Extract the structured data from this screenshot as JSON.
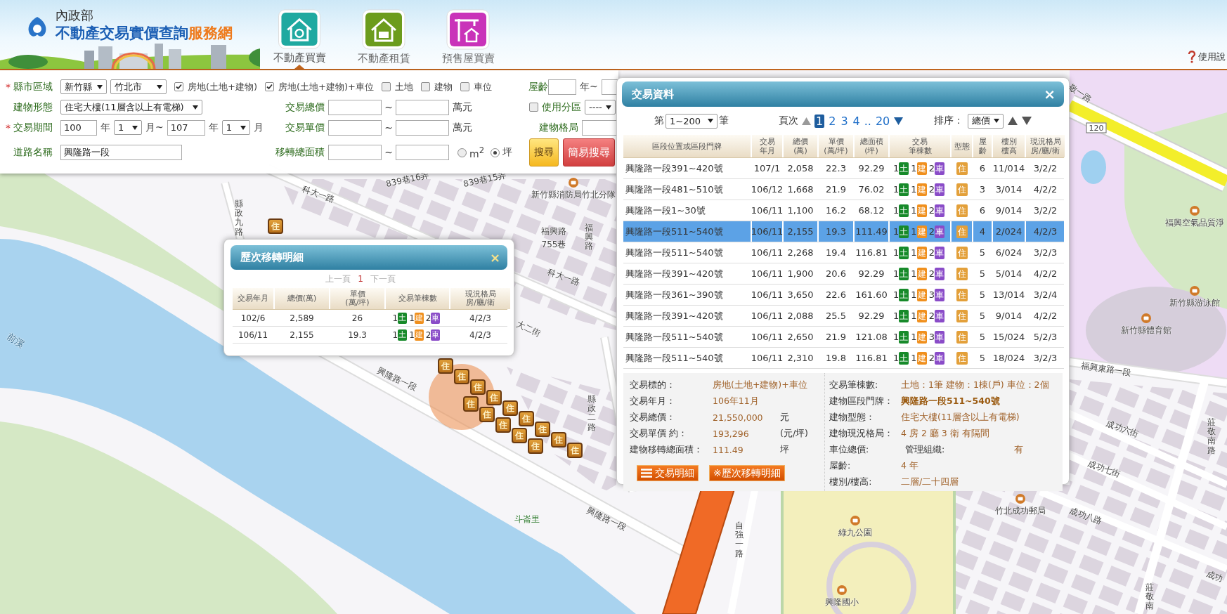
{
  "header": {
    "org": "內政部",
    "title": "不動產交易實價查詢",
    "title_accent": "服務網",
    "nav": [
      {
        "label": "不動產買賣",
        "kind": "sale",
        "selected": true
      },
      {
        "label": "不動產租賃",
        "kind": "rent",
        "selected": false
      },
      {
        "label": "預售屋買賣",
        "kind": "presale",
        "selected": false
      }
    ],
    "help": "使用說"
  },
  "search": {
    "region": {
      "required_mark": "*",
      "label": "縣市區域",
      "county": "新竹縣",
      "district": "竹北市"
    },
    "targets": [
      {
        "label": "房地(土地+建物)",
        "checked": true
      },
      {
        "label": "房地(土地+建物)+車位",
        "checked": true
      },
      {
        "label": "土地",
        "checked": false
      },
      {
        "label": "建物",
        "checked": false
      },
      {
        "label": "車位",
        "checked": false
      }
    ],
    "age": {
      "label": "屋齡",
      "unit": "年~"
    },
    "building_type": {
      "label": "建物形態",
      "value": "住宅大樓(11層含以上有電梯)"
    },
    "total_price": {
      "label": "交易總價",
      "sep": "~",
      "unit": "萬元"
    },
    "zoning": {
      "label": "使用分區",
      "checked": false,
      "value": "----"
    },
    "period": {
      "required_mark": "*",
      "label": "交易期間",
      "from_year": "100",
      "year_unit": "年",
      "from_month": "1",
      "month_unit": "月~",
      "to_year": "107",
      "to_year_unit": "年",
      "to_month": "1",
      "to_month_unit": "月"
    },
    "unit_price": {
      "label": "交易單價",
      "sep": "~",
      "unit": "萬元"
    },
    "layout": {
      "label": "建物格局"
    },
    "road": {
      "label": "道路名稱",
      "value": "興隆路一段"
    },
    "area": {
      "label": "移轉總面積",
      "sep": "~",
      "units": [
        {
          "label": "m$^{2}$",
          "selected": false
        },
        {
          "label": "坪",
          "selected": true
        }
      ]
    },
    "buttons": [
      {
        "label": "搜尋",
        "kind": "search"
      },
      {
        "label": "簡易搜尋",
        "kind": "simple"
      }
    ]
  },
  "deals": {
    "title": "交易資料",
    "close": "×",
    "range": {
      "prefix": "第",
      "value": "1~200",
      "suffix": "筆"
    },
    "pager": {
      "label": "頁次",
      "gap": "..",
      "pages": [
        {
          "label": "1",
          "selected": true
        },
        {
          "label": "2",
          "selected": false
        },
        {
          "label": "3",
          "selected": false
        },
        {
          "label": "4",
          "selected": false
        },
        {
          "label": "20",
          "selected": false
        }
      ]
    },
    "sort": {
      "label": "排序：",
      "value": "總價"
    },
    "columns": [
      [
        "區段位置或區段門牌"
      ],
      [
        "交易",
        "年月"
      ],
      [
        "總價",
        "(萬)"
      ],
      [
        "單價",
        "(萬/坪)"
      ],
      [
        "總面積",
        "(坪)"
      ],
      [
        "交易",
        "筆棟數"
      ],
      [
        "型態"
      ],
      [
        "屋",
        "齡"
      ],
      [
        "樓別",
        "樓高"
      ],
      [
        "現況格局",
        "房/廳/衛"
      ]
    ],
    "rows": [
      {
        "address": "興隆路一段391~420號",
        "date": "107/1",
        "total": "2,058",
        "unit": "22.3",
        "area": "92.29",
        "counts": [
          {
            "n": "1",
            "tag": "土",
            "kind": "land"
          },
          {
            "n": "1",
            "tag": "建",
            "kind": "building"
          },
          {
            "n": "2",
            "tag": "車",
            "kind": "parking"
          }
        ],
        "type": "住",
        "age": "6",
        "floor": "11/014",
        "layout": "3/2/2",
        "selected": false
      },
      {
        "address": "興隆路一段481~510號",
        "date": "106/12",
        "total": "1,668",
        "unit": "21.9",
        "area": "76.02",
        "counts": [
          {
            "n": "1",
            "tag": "土",
            "kind": "land"
          },
          {
            "n": "1",
            "tag": "建",
            "kind": "building"
          },
          {
            "n": "2",
            "tag": "車",
            "kind": "parking"
          }
        ],
        "type": "住",
        "age": "3",
        "floor": "3/014",
        "layout": "4/2/2",
        "selected": false
      },
      {
        "address": "興隆路一段1~30號",
        "date": "106/11",
        "total": "1,100",
        "unit": "16.2",
        "area": "68.12",
        "counts": [
          {
            "n": "1",
            "tag": "土",
            "kind": "land"
          },
          {
            "n": "1",
            "tag": "建",
            "kind": "building"
          },
          {
            "n": "2",
            "tag": "車",
            "kind": "parking"
          }
        ],
        "type": "住",
        "age": "6",
        "floor": "9/014",
        "layout": "3/2/2",
        "selected": false
      },
      {
        "address": "興隆路一段511~540號",
        "date": "106/11",
        "total": "2,155",
        "unit": "19.3",
        "area": "111.49",
        "counts": [
          {
            "n": "1",
            "tag": "土",
            "kind": "land"
          },
          {
            "n": "1",
            "tag": "建",
            "kind": "building"
          },
          {
            "n": "2",
            "tag": "車",
            "kind": "parking"
          }
        ],
        "type": "住",
        "age": "4",
        "floor": "2/024",
        "layout": "4/2/3",
        "selected": true
      },
      {
        "address": "興隆路一段511~540號",
        "date": "106/11",
        "total": "2,268",
        "unit": "19.4",
        "area": "116.81",
        "counts": [
          {
            "n": "1",
            "tag": "土",
            "kind": "land"
          },
          {
            "n": "1",
            "tag": "建",
            "kind": "building"
          },
          {
            "n": "2",
            "tag": "車",
            "kind": "parking"
          }
        ],
        "type": "住",
        "age": "5",
        "floor": "6/024",
        "layout": "3/2/3",
        "selected": false
      },
      {
        "address": "興隆路一段391~420號",
        "date": "106/11",
        "total": "1,900",
        "unit": "20.6",
        "area": "92.29",
        "counts": [
          {
            "n": "1",
            "tag": "土",
            "kind": "land"
          },
          {
            "n": "1",
            "tag": "建",
            "kind": "building"
          },
          {
            "n": "2",
            "tag": "車",
            "kind": "parking"
          }
        ],
        "type": "住",
        "age": "5",
        "floor": "5/014",
        "layout": "4/2/2",
        "selected": false
      },
      {
        "address": "興隆路一段361~390號",
        "date": "106/11",
        "total": "3,650",
        "unit": "22.6",
        "area": "161.60",
        "counts": [
          {
            "n": "1",
            "tag": "土",
            "kind": "land"
          },
          {
            "n": "1",
            "tag": "建",
            "kind": "building"
          },
          {
            "n": "3",
            "tag": "車",
            "kind": "parking"
          }
        ],
        "type": "住",
        "age": "5",
        "floor": "13/014",
        "layout": "3/2/4",
        "selected": false
      },
      {
        "address": "興隆路一段391~420號",
        "date": "106/11",
        "total": "2,088",
        "unit": "25.5",
        "area": "92.29",
        "counts": [
          {
            "n": "1",
            "tag": "土",
            "kind": "land"
          },
          {
            "n": "1",
            "tag": "建",
            "kind": "building"
          },
          {
            "n": "2",
            "tag": "車",
            "kind": "parking"
          }
        ],
        "type": "住",
        "age": "5",
        "floor": "9/014",
        "layout": "4/2/2",
        "selected": false
      },
      {
        "address": "興隆路一段511~540號",
        "date": "106/11",
        "total": "2,650",
        "unit": "21.9",
        "area": "121.08",
        "counts": [
          {
            "n": "1",
            "tag": "土",
            "kind": "land"
          },
          {
            "n": "1",
            "tag": "建",
            "kind": "building"
          },
          {
            "n": "3",
            "tag": "車",
            "kind": "parking"
          }
        ],
        "type": "住",
        "age": "5",
        "floor": "15/024",
        "layout": "5/2/3",
        "selected": false
      },
      {
        "address": "興隆路一段511~540號",
        "date": "106/11",
        "total": "2,310",
        "unit": "19.8",
        "area": "116.81",
        "counts": [
          {
            "n": "1",
            "tag": "土",
            "kind": "land"
          },
          {
            "n": "1",
            "tag": "建",
            "kind": "building"
          },
          {
            "n": "2",
            "tag": "車",
            "kind": "parking"
          }
        ],
        "type": "住",
        "age": "5",
        "floor": "18/024",
        "layout": "3/2/3",
        "selected": false
      }
    ],
    "detail": {
      "left": [
        {
          "label": "交易標的：",
          "value": "房地(土地+建物)+車位"
        },
        {
          "label": "交易年月：",
          "value": "106年11月"
        },
        {
          "label": "交易總價：",
          "value": "21,550,000",
          "unit": "元"
        },
        {
          "label": "交易單價 約：",
          "value": "193,296",
          "unit": "(元/坪)"
        },
        {
          "label": "建物移轉總面積：",
          "value": "111.49",
          "unit": "坪"
        }
      ],
      "buttons": [
        {
          "label": "交易明細",
          "kind": "list"
        },
        {
          "label": "※歷次移轉明細",
          "kind": "history"
        }
      ],
      "right": [
        {
          "label": "交易筆棟數:",
          "value": "土地：1筆 建物：1棟(戶) 車位：2個",
          "bold": false
        },
        {
          "label": "建物區段門牌：",
          "value": "興隆路一段511~540號",
          "bold": true
        },
        {
          "label": "建物型態：",
          "value": "住宅大樓(11層含以上有電梯)",
          "bold": false
        },
        {
          "label": "建物現況格局：",
          "value": "4 房 2 廳 3 衛 有隔間",
          "bold": false
        },
        {
          "label": "車位總價:",
          "sub_label": "管理組織:",
          "sub_value": "有",
          "bold": false
        },
        {
          "label": "屋齡:",
          "value": "4  年",
          "bold": false
        },
        {
          "label": "樓別/樓高:",
          "value": "二層/二十四層",
          "bold": false
        }
      ]
    }
  },
  "history": {
    "title": "歷次移轉明細",
    "close": "×",
    "pager": {
      "prev": "上一頁",
      "current": "1",
      "next": "下一頁"
    },
    "columns": [
      [
        "交易年月"
      ],
      [
        "總價(萬)"
      ],
      [
        "單價",
        "(萬/坪)"
      ],
      [
        "交易筆棟數"
      ],
      [
        "現況格局",
        "房/廳/衛"
      ]
    ],
    "rows": [
      {
        "date": "102/6",
        "total": "2,589",
        "unit": "26",
        "counts": [
          {
            "n": "1",
            "tag": "土",
            "kind": "land"
          },
          {
            "n": "1",
            "tag": "建",
            "kind": "building"
          },
          {
            "n": "2",
            "tag": "車",
            "kind": "parking"
          }
        ],
        "layout": "4/2/3"
      },
      {
        "date": "106/11",
        "total": "2,155",
        "unit": "19.3",
        "counts": [
          {
            "n": "1",
            "tag": "土",
            "kind": "land"
          },
          {
            "n": "1",
            "tag": "建",
            "kind": "building"
          },
          {
            "n": "2",
            "tag": "車",
            "kind": "parking"
          }
        ],
        "layout": "4/2/3"
      }
    ]
  },
  "map": {
    "labels": [
      {
        "text": "前溪",
        "kind": "water"
      },
      {
        "text": "縣政九路",
        "kind": "vertical"
      },
      {
        "text": "839巷16弄",
        "kind": "road"
      },
      {
        "text": "839巷15弄",
        "kind": "road"
      },
      {
        "text": "新竹縣消防局竹北分隊",
        "kind": "place"
      },
      {
        "text": "科大一路",
        "kind": "road"
      },
      {
        "text": "福興路",
        "kind": "road"
      },
      {
        "text": "755巷",
        "kind": "road"
      },
      {
        "text": "福興路",
        "kind": "vertical"
      },
      {
        "text": "科大一路",
        "kind": "road"
      },
      {
        "text": "大二街",
        "kind": "road"
      },
      {
        "text": "興隆路一段",
        "kind": "road"
      },
      {
        "text": "縣政二路",
        "kind": "vertical"
      },
      {
        "text": "斗崙里",
        "kind": "area"
      },
      {
        "text": "興隆路一段",
        "kind": "road"
      },
      {
        "text": "自強一路",
        "kind": "vertical"
      },
      {
        "text": "綠九公園",
        "kind": "place"
      },
      {
        "text": "竹北成功郵局",
        "kind": "place"
      },
      {
        "text": "興隆國小",
        "kind": "place"
      },
      {
        "text": "敬一路",
        "kind": "road"
      },
      {
        "text": "120",
        "kind": "shield"
      },
      {
        "text": "福興空氣品質淨",
        "kind": "place"
      },
      {
        "text": "新竹縣游泳館",
        "kind": "place"
      },
      {
        "text": "新竹縣體育館",
        "kind": "place"
      },
      {
        "text": "福興東路一段",
        "kind": "road"
      },
      {
        "text": "成功六街",
        "kind": "road"
      },
      {
        "text": "莊敬南路",
        "kind": "vertical"
      },
      {
        "text": "成功七街",
        "kind": "road"
      },
      {
        "text": "成功八路",
        "kind": "road"
      },
      {
        "text": "成功",
        "kind": "road"
      },
      {
        "text": "莊敬南",
        "kind": "vertical"
      }
    ],
    "markers": [
      {
        "label": "住"
      },
      {
        "label": "住"
      },
      {
        "label": "住"
      },
      {
        "label": "住"
      },
      {
        "label": "住"
      },
      {
        "label": "住"
      },
      {
        "label": "住"
      },
      {
        "label": "住"
      },
      {
        "label": "住"
      },
      {
        "label": "住"
      },
      {
        "label": "住"
      },
      {
        "label": "住"
      },
      {
        "label": "住"
      },
      {
        "label": "住"
      },
      {
        "label": "住"
      }
    ]
  }
}
